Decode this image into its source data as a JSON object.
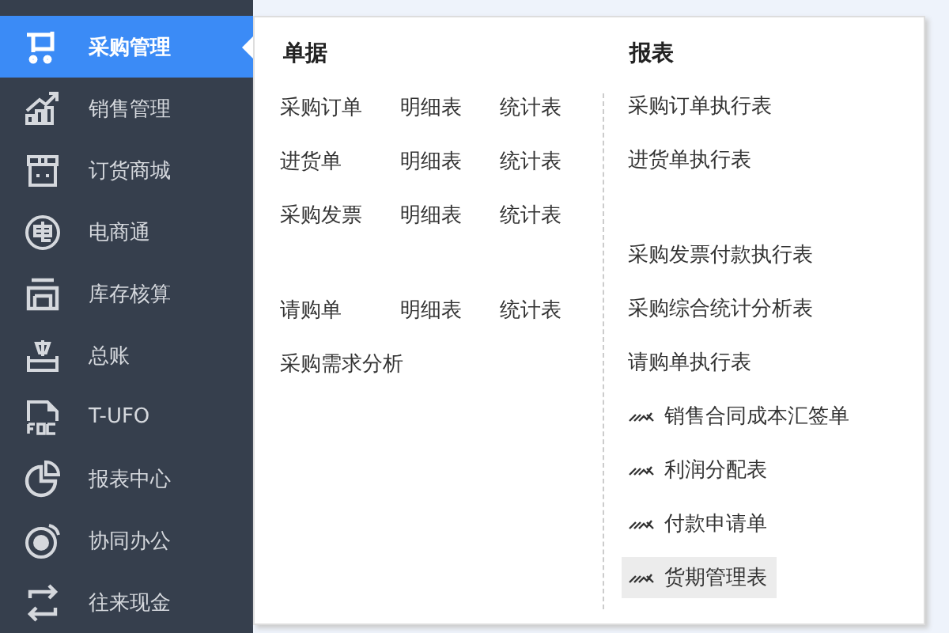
{
  "sidebar": {
    "items": [
      {
        "label": "采购管理",
        "selected": true
      },
      {
        "label": "销售管理",
        "selected": false
      },
      {
        "label": "订货商城",
        "selected": false
      },
      {
        "label": "电商通",
        "selected": false
      },
      {
        "label": "库存核算",
        "selected": false
      },
      {
        "label": "总账",
        "selected": false
      },
      {
        "label": "T-UFO",
        "selected": false
      },
      {
        "label": "报表中心",
        "selected": false
      },
      {
        "label": "协同办公",
        "selected": false
      },
      {
        "label": "往来现金",
        "selected": false
      }
    ]
  },
  "menu": {
    "documents": {
      "title": "单据",
      "groups": [
        [
          {
            "name": "采购订单",
            "detail": "明细表",
            "summary": "统计表"
          },
          {
            "name": "进货单",
            "detail": "明细表",
            "summary": "统计表"
          },
          {
            "name": "采购发票",
            "detail": "明细表",
            "summary": "统计表"
          }
        ],
        [
          {
            "name": "请购单",
            "detail": "明细表",
            "summary": "统计表"
          },
          {
            "name": "采购需求分析"
          }
        ]
      ]
    },
    "reports": {
      "title": "报表",
      "groups": [
        [
          {
            "label": "采购订单执行表",
            "kind": "standard",
            "selected": false
          },
          {
            "label": "进货单执行表",
            "kind": "standard",
            "selected": false
          }
        ],
        [
          {
            "label": "采购发票付款执行表",
            "kind": "standard",
            "selected": false
          },
          {
            "label": "采购综合统计分析表",
            "kind": "standard",
            "selected": false
          },
          {
            "label": "请购单执行表",
            "kind": "standard",
            "selected": false
          },
          {
            "label": "销售合同成本汇签单",
            "kind": "custom",
            "selected": false
          },
          {
            "label": "利润分配表",
            "kind": "custom",
            "selected": false
          },
          {
            "label": "付款申请单",
            "kind": "custom",
            "selected": false
          },
          {
            "label": "货期管理表",
            "kind": "custom",
            "selected": true
          }
        ]
      ]
    }
  }
}
